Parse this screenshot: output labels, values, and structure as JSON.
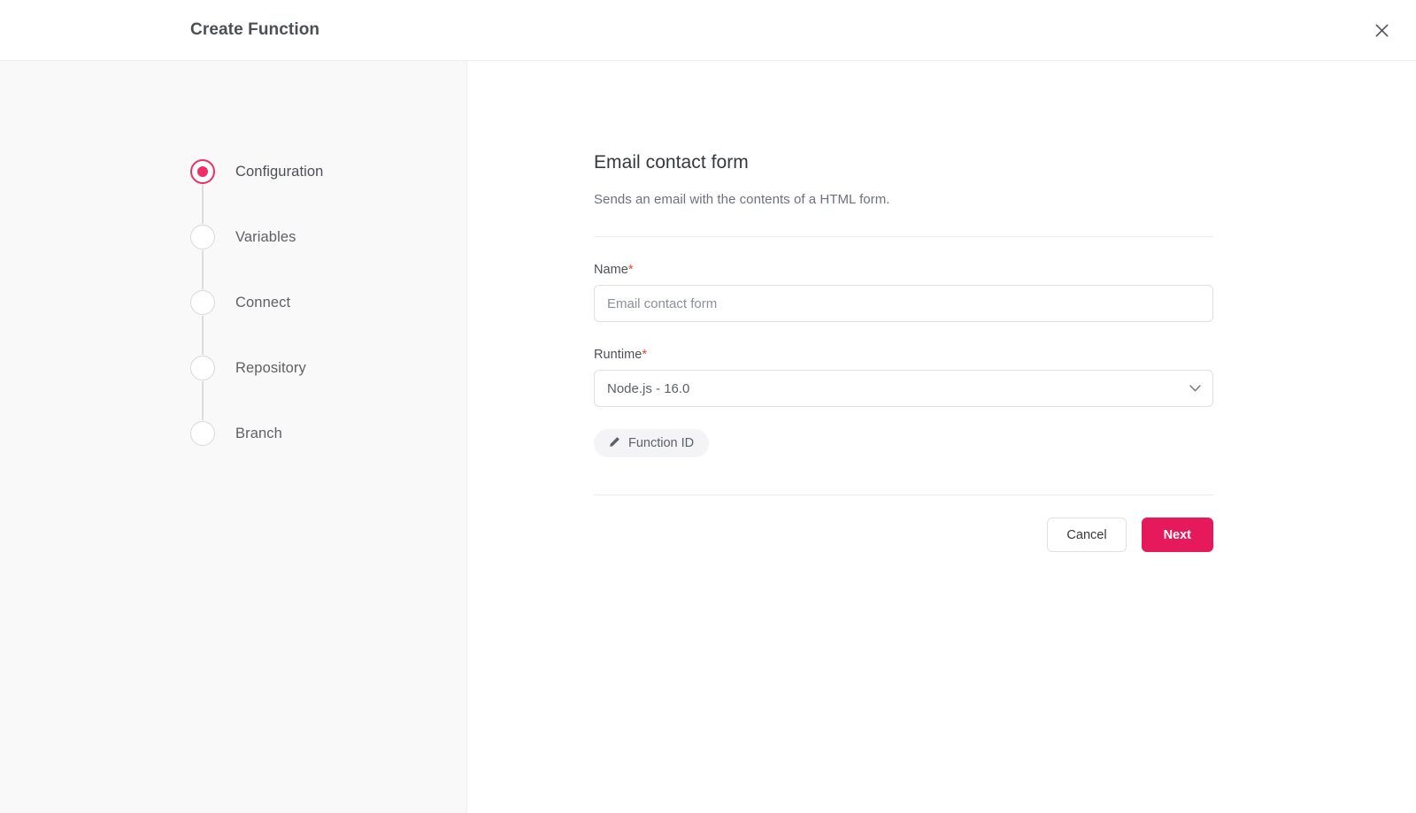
{
  "header": {
    "title": "Create Function",
    "close_icon": "close-icon"
  },
  "sidebar": {
    "steps": [
      {
        "label": "Configuration",
        "state": "active"
      },
      {
        "label": "Variables",
        "state": "pending"
      },
      {
        "label": "Connect",
        "state": "pending"
      },
      {
        "label": "Repository",
        "state": "pending"
      },
      {
        "label": "Branch",
        "state": "pending"
      }
    ]
  },
  "main": {
    "title": "Email contact form",
    "subtitle": "Sends an email with the contents of a HTML form.",
    "fields": {
      "name": {
        "label": "Name",
        "required_mark": "*",
        "value": "",
        "placeholder": "Email contact form"
      },
      "runtime": {
        "label": "Runtime",
        "required_mark": "*",
        "selected": "Node.js - 16.0",
        "chevron_icon": "chevron-down-icon"
      }
    },
    "function_id_button": {
      "label": "Function ID",
      "icon": "pencil-icon"
    },
    "actions": {
      "cancel_label": "Cancel",
      "next_label": "Next"
    }
  },
  "colors": {
    "accent_pink": "#e5195c",
    "step_active": "#f02e65",
    "required_red": "#f0432e",
    "sidebar_bg": "#f9f9fa",
    "border": "#ededf0"
  }
}
